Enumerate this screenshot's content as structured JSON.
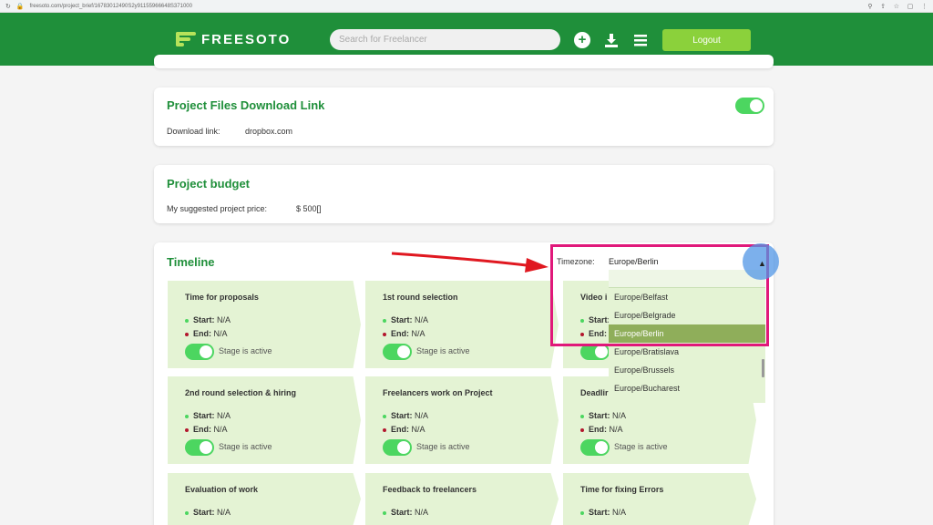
{
  "browser": {
    "url": "freesoto.com/project_brief/16783012490S2y91155966648S371000"
  },
  "header": {
    "logo_text": "FREESOTO",
    "search_placeholder": "Search for Freelancer",
    "logout_label": "Logout",
    "accent_color": "#1f8f3a"
  },
  "files_card": {
    "title": "Project Files Download Link",
    "download_label": "Download link:",
    "download_value": "dropbox.com",
    "toggle_on": true
  },
  "budget_card": {
    "title": "Project budget",
    "price_label": "My suggested project price:",
    "price_value": "$ 500[]"
  },
  "timeline": {
    "title": "Timeline",
    "timezone_label": "Timezone:",
    "timezone_selected": "Europe/Berlin",
    "timezone_options": [
      "Europe/Belfast",
      "Europe/Belgrade",
      "Europe/Berlin",
      "Europe/Bratislava",
      "Europe/Brussels",
      "Europe/Bucharest"
    ],
    "start_label": "Start:",
    "end_label": "End:",
    "active_label": "Stage is active",
    "stages": [
      {
        "title": "Time for proposals",
        "start": "N/A",
        "end": "N/A"
      },
      {
        "title": "1st round selection",
        "start": "N/A",
        "end": "N/A"
      },
      {
        "title": "Video i",
        "start": "",
        "end": ""
      },
      {
        "title": "2nd round selection & hiring",
        "start": "N/A",
        "end": "N/A"
      },
      {
        "title": "Freelancers work on Project",
        "start": "N/A",
        "end": "N/A"
      },
      {
        "title": "Deadlir",
        "start": "N/A",
        "end": "N/A"
      },
      {
        "title": "Evaluation of work",
        "start": "N/A"
      },
      {
        "title": "Feedback to freelancers",
        "start": "N/A"
      },
      {
        "title": "Time for fixing Errors",
        "start": "N/A"
      }
    ]
  }
}
